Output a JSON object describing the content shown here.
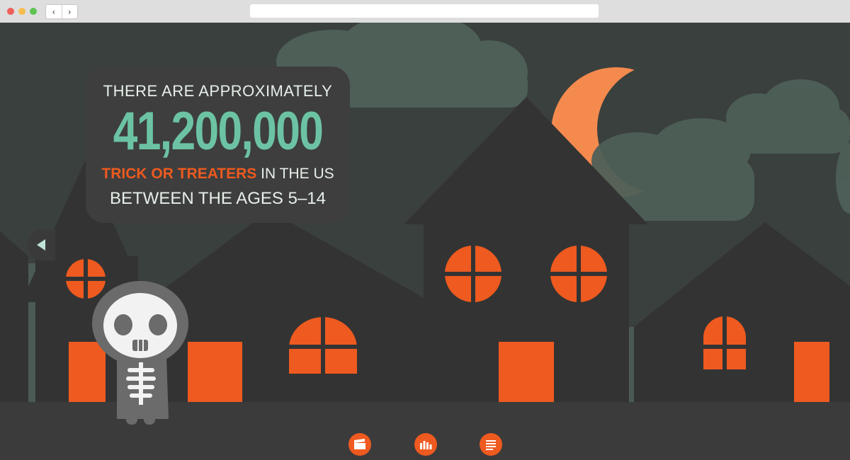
{
  "browser": {
    "back_glyph": "‹",
    "forward_glyph": "›",
    "traffic_lights": [
      "#ee5f5a",
      "#f5bd4f",
      "#5fc454"
    ]
  },
  "stat": {
    "line1": "THERE ARE APPROXIMATELY",
    "number": "41,200,000",
    "highlight": "TRICK OR TREATERS",
    "line3_rest": " IN THE US",
    "line4": "BETWEEN THE AGES 5–14"
  },
  "colors": {
    "orange": "#ee5a1f",
    "teal": "#6cc3a4",
    "sky": "#3a403d",
    "house": "#333333",
    "cloud": "#4e5f58",
    "moon": "#f58a4f"
  },
  "footer_icons": [
    "video-icon",
    "chart-icon",
    "text-icon"
  ]
}
